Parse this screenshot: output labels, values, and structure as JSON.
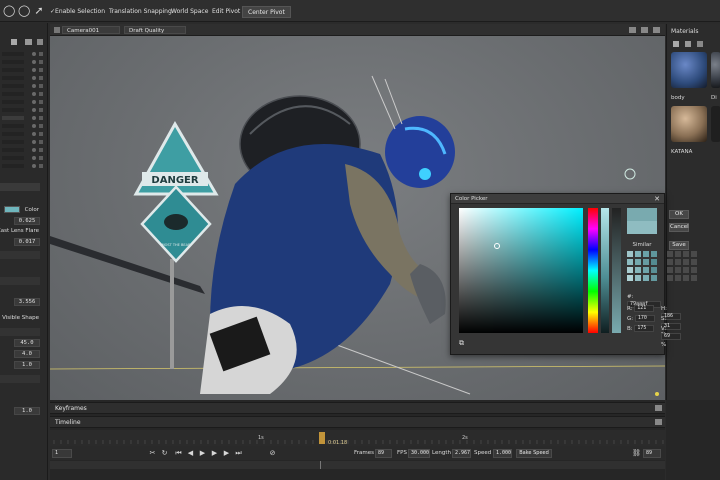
{
  "toolbar": {
    "tools": [
      {
        "icon": "circle-select-icon",
        "glyph": "◯"
      },
      {
        "icon": "lasso-select-icon",
        "glyph": "◯"
      },
      {
        "icon": "pointer-select-icon",
        "glyph": "➚"
      }
    ],
    "enable_selection": "✓Enable Selection",
    "translation_snapping": "Translation Snapping",
    "world_space": "World Space",
    "edit_pivot": "Edit Pivot",
    "center_pivot": "Center Pivot"
  },
  "viewport": {
    "camera": "Camera001",
    "quality": "Draft Quality"
  },
  "scene": {
    "sign_text": "DANGER",
    "sign2_text": "MOST THE BEAR"
  },
  "left_panel": {
    "color_label": "Color",
    "color_value": "#6fb6bd",
    "value_1": "0.625",
    "lens_flare_label": "Cast Lens Flare",
    "value_2": "0.017",
    "value_3": "3.556",
    "visible_shape_label": "Visible Shape",
    "value_4": "45.0",
    "value_5": "4.0",
    "value_6": "1.0",
    "value_7": "1.0"
  },
  "materials": {
    "title": "Materials",
    "items": [
      {
        "label": "body",
        "color": "#2d4a7a"
      },
      {
        "label": "Di",
        "color": "#3a3f48"
      },
      {
        "label": "KATANA",
        "color": "#8a7055"
      },
      {
        "label": "",
        "color": "#222222"
      }
    ]
  },
  "color_picker": {
    "title": "Color Picker",
    "ok": "OK",
    "cancel": "Cancel",
    "similar": "Similar",
    "save": "Save",
    "hex_label": "#:",
    "hex_value": "79aaaf",
    "r_label": "R:",
    "r_value": "121",
    "g_label": "G:",
    "g_value": "170",
    "b_label": "B:",
    "b_value": "175",
    "h_label": "H:",
    "h_value": "186",
    "s_label": "S:",
    "s_value": "31",
    "v_label": "V:",
    "v_value": "69",
    "pct": "%",
    "hue_color": "#00f0ff",
    "swatches": [
      "#9fc5c9",
      "#7fb3b9",
      "#6aa2a8",
      "#5f969c",
      "#8dbcc1",
      "#74a9ae",
      "#669ca2",
      "#548b91",
      "#a9cdd1",
      "#85b6bb",
      "#6ea4aa",
      "#5a9096",
      "#b0d3d6",
      "#93bec3",
      "#7aadb3",
      "#63999f"
    ]
  },
  "bottom": {
    "keyframes": "Keyframes",
    "timeline": "Timeline",
    "marker_1": "1s",
    "marker_2": "2s",
    "current_time": "0:01.18",
    "start_frame": "1",
    "frames_label": "Frames",
    "frames_value": "89",
    "fps_label": "FPS",
    "fps_value": "30.000",
    "length_label": "Length",
    "length_value": "2.967",
    "speed_label": "Speed",
    "speed_value": "1.000",
    "bake_speed": "Bake Speed",
    "end_frame": "89"
  }
}
